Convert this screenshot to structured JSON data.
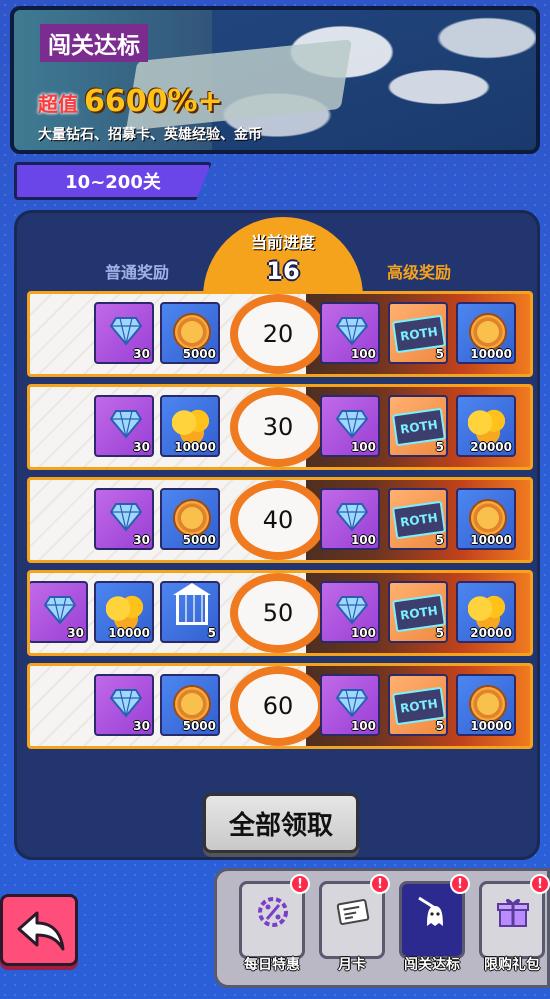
{
  "banner": {
    "title": "闯关达标",
    "value_label": "超值",
    "value_number": "6600%+",
    "description": "大量钻石、招募卡、英雄经验、金币"
  },
  "range_tab": "10~200关",
  "progress": {
    "label": "当前进度",
    "value": "16"
  },
  "columns": {
    "normal": "普通奖励",
    "premium": "高级奖励"
  },
  "rows": [
    {
      "stage": "20",
      "normal": [
        {
          "icon": "diamond-icon",
          "qty": "30"
        },
        {
          "icon": "coin-icon",
          "qty": "5000"
        }
      ],
      "premium": [
        {
          "icon": "diamond-icon",
          "qty": "100"
        },
        {
          "icon": "roth-card-icon",
          "qty": "5",
          "text": "ROTH"
        },
        {
          "icon": "coin-icon",
          "qty": "10000"
        }
      ]
    },
    {
      "stage": "30",
      "normal": [
        {
          "icon": "diamond-icon",
          "qty": "30"
        },
        {
          "icon": "gold-pile-icon",
          "qty": "10000"
        }
      ],
      "premium": [
        {
          "icon": "diamond-icon",
          "qty": "100"
        },
        {
          "icon": "roth-card-icon",
          "qty": "5",
          "text": "ROTH"
        },
        {
          "icon": "gold-pile-icon",
          "qty": "20000"
        }
      ]
    },
    {
      "stage": "40",
      "normal": [
        {
          "icon": "diamond-icon",
          "qty": "30"
        },
        {
          "icon": "coin-icon",
          "qty": "5000"
        }
      ],
      "premium": [
        {
          "icon": "diamond-icon",
          "qty": "100"
        },
        {
          "icon": "roth-card-icon",
          "qty": "5",
          "text": "ROTH"
        },
        {
          "icon": "coin-icon",
          "qty": "10000"
        }
      ]
    },
    {
      "stage": "50",
      "normal": [
        {
          "icon": "diamond-icon",
          "qty": "30"
        },
        {
          "icon": "gold-pile-icon",
          "qty": "10000"
        },
        {
          "icon": "building-icon",
          "qty": "5"
        }
      ],
      "premium": [
        {
          "icon": "diamond-icon",
          "qty": "100"
        },
        {
          "icon": "roth-card-icon",
          "qty": "5",
          "text": "ROTH"
        },
        {
          "icon": "gold-pile-icon",
          "qty": "20000"
        }
      ]
    },
    {
      "stage": "60",
      "normal": [
        {
          "icon": "diamond-icon",
          "qty": "30"
        },
        {
          "icon": "coin-icon",
          "qty": "5000"
        }
      ],
      "premium": [
        {
          "icon": "diamond-icon",
          "qty": "100"
        },
        {
          "icon": "roth-card-icon",
          "qty": "5",
          "text": "ROTH"
        },
        {
          "icon": "coin-icon",
          "qty": "10000"
        }
      ]
    }
  ],
  "claim_all": "全部领取",
  "nav": [
    {
      "label": "每日特惠",
      "icon": "discount-gear-icon",
      "badge": "!"
    },
    {
      "label": "月卡",
      "icon": "month-card-icon",
      "badge": "!"
    },
    {
      "label": "闯关达标",
      "icon": "ghost-sword-icon",
      "badge": "!",
      "active": true
    },
    {
      "label": "限购礼包",
      "icon": "gift-icon",
      "badge": "!"
    }
  ],
  "colors": {
    "accent": "#f5a21c",
    "panel": "#23356e",
    "tab_active": "#2d2a8f",
    "back_button": "#ff4e7a"
  }
}
